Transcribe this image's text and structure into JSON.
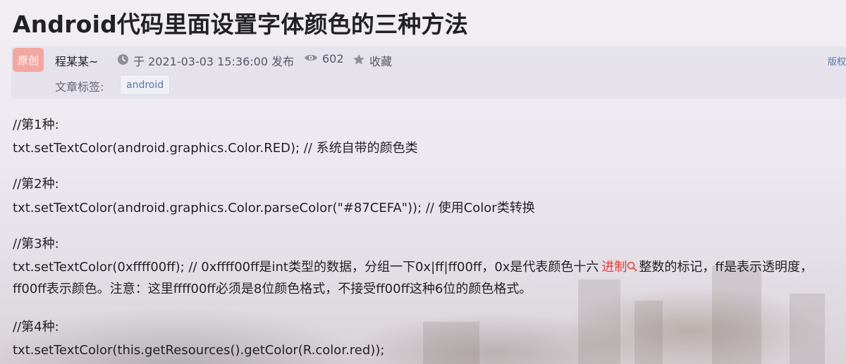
{
  "article": {
    "title": "Android代码里面设置字体颜色的三种方法",
    "badge": "原创",
    "author": "程某某~",
    "date": "于 2021-03-03 15:36:00 发布",
    "views": "602",
    "collect": "收藏",
    "copyright": "版权",
    "tags_label": "文章标签:",
    "tags": [
      "android"
    ]
  },
  "content": {
    "m1_label": "//第1种:",
    "m1_code": "txt.setTextColor(android.graphics.Color.RED); // 系统自带的颜色类",
    "m2_label": "//第2种:",
    "m2_code": "txt.setTextColor(android.graphics.Color.parseColor(\"#87CEFA\")); // 使用Color类转换",
    "m3_label": "//第3种:",
    "m3_code_a": "txt.setTextColor(0xffff00ff); // 0xffff00ff是int类型的数据，分组一下0x|ff|ff00ff，0x是代表颜色十六",
    "m3_keyword": "进制",
    "m3_code_b": "整数的标记，ff是表示透明度，",
    "m3_code_c": "ff00ff表示颜色。注意：这里ffff00ff必须是8位颜色格式，不接受ff00ff这种6位的颜色格式。",
    "m4_label": "//第4种:",
    "m4_code": "txt.setTextColor(this.getResources().getColor(R.color.red));"
  },
  "colors": {
    "keyword_link": "#e33e33",
    "tag_text": "#5a77a8",
    "badge_bg": "#f2a7a0"
  },
  "icons": [
    "clock-icon",
    "eye-icon",
    "star-icon",
    "search-icon"
  ]
}
